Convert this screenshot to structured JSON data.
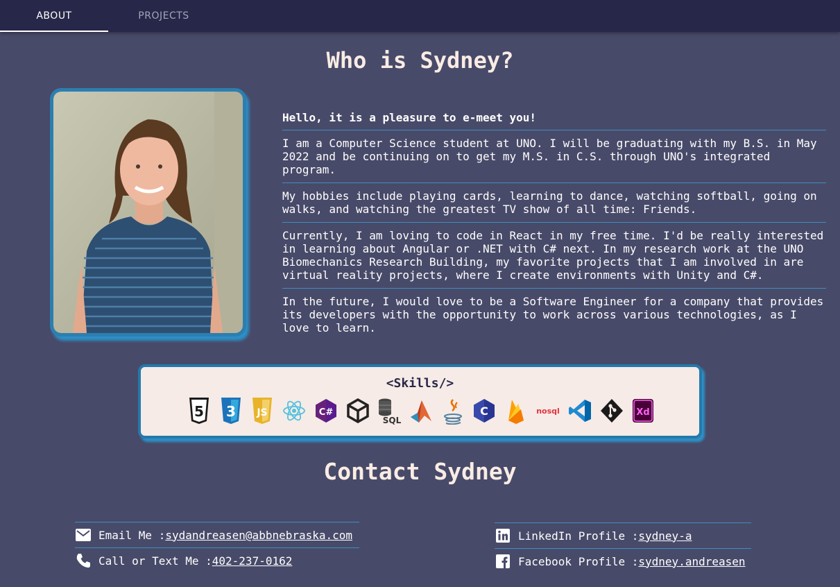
{
  "nav": {
    "tabs": [
      {
        "label": "ABOUT"
      },
      {
        "label": "PROJECTS"
      }
    ]
  },
  "about": {
    "heading": "Who is Sydney?",
    "greeting": "Hello, it is a pleasure to e-meet you!",
    "paragraphs": [
      "I am a Computer Science student at UNO. I will be graduating with my B.S. in May 2022 and be continuing on to get my M.S. in C.S. through UNO's integrated program.",
      "My hobbies include playing cards, learning to dance, watching softball, going on walks, and watching the greatest TV show of all time: Friends.",
      "Currently, I am loving to code in React in my free time. I'd be really interested in learning about Angular or .NET with C# next. In my research work at the UNO Biomechanics Research Building, my favorite projects that I am involved in are virtual reality projects, where I create environments with Unity and C#.",
      "In the future, I would love to be a Software Engineer for a company that provides its developers with the opportunity to work across various technologies, as I love to learn."
    ]
  },
  "skills": {
    "title": "<Skills/>",
    "icons": [
      "html5-icon",
      "css3-icon",
      "javascript-icon",
      "react-icon",
      "csharp-icon",
      "unity-icon",
      "sql-icon",
      "matlab-icon",
      "java-icon",
      "c-language-icon",
      "firebase-icon",
      "nosql-icon",
      "vscode-icon",
      "git-icon",
      "adobe-xd-icon"
    ],
    "icon_texts": {
      "html5": "5",
      "css3": "3",
      "js": "JS",
      "csharp": "C#",
      "sql": "SQL",
      "java": "☕",
      "c": "C",
      "nosql": "nosql",
      "xd": "Xd"
    }
  },
  "contact": {
    "heading": "Contact Sydney",
    "email_label": "Email Me : ",
    "email": "sydandreasen@abbnebraska.com",
    "phone_label": "Call or Text Me : ",
    "phone": "402-237-0162",
    "linkedin_label": "LinkedIn Profile : ",
    "linkedin": "sydney-a",
    "facebook_label": "Facebook Profile : ",
    "facebook": "sydney.andreasen"
  },
  "colors": {
    "background": "#484a69",
    "appbar": "#272849",
    "accent": "#2b7fb0",
    "card": "#f6ebe6"
  }
}
